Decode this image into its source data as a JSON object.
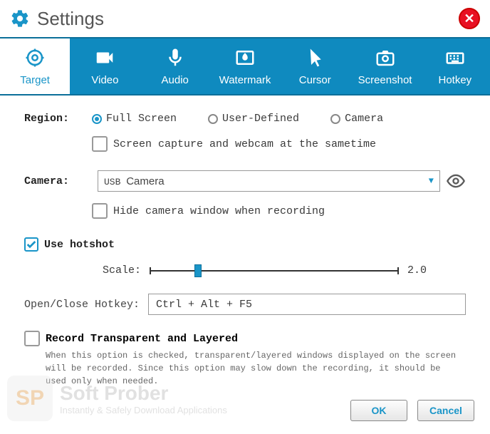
{
  "window": {
    "title": "Settings"
  },
  "tabs": {
    "0": {
      "label": "Target"
    },
    "1": {
      "label": "Video"
    },
    "2": {
      "label": "Audio"
    },
    "3": {
      "label": "Watermark"
    },
    "4": {
      "label": "Cursor"
    },
    "5": {
      "label": "Screenshot"
    },
    "6": {
      "label": "Hotkey"
    }
  },
  "region": {
    "label": "Region:",
    "full": "Full Screen",
    "user": "User-Defined",
    "camera": "Camera",
    "both": "Screen capture and webcam at the sametime"
  },
  "camera": {
    "label": "Camera:",
    "value_prefix": "USB ",
    "value": "Camera",
    "hide": "Hide camera window when recording"
  },
  "hotshot": {
    "label": "Use hotshot",
    "scale_label": "Scale:",
    "scale_value": "2.0"
  },
  "hotkey": {
    "label": "Open/Close Hotkey:",
    "value": "Ctrl + Alt + F5"
  },
  "record": {
    "label": "Record Transparent and Layered",
    "desc": "When this option is checked, transparent/layered windows displayed on the screen will be recorded. Since this option may slow down the recording, it should be used only when needed."
  },
  "buttons": {
    "ok": "OK",
    "cancel": "Cancel"
  },
  "watermark": {
    "badge": "SP",
    "title": "Soft Prober",
    "sub": "Instantly & Safely Download Applications"
  }
}
